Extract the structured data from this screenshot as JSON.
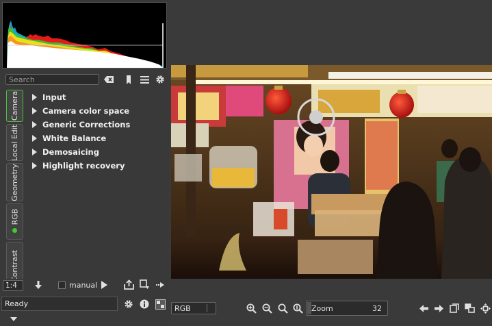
{
  "search": {
    "placeholder": "Search",
    "value": ""
  },
  "toolbar_icons": [
    "clear-search-icon",
    "bookmark-icon",
    "menu-icon",
    "gear-icon"
  ],
  "tabs": [
    {
      "label": "Camera",
      "active": true
    },
    {
      "label": "Local Edit",
      "active": false
    },
    {
      "label": "Geometry",
      "active": false
    },
    {
      "label": "RGB",
      "active": false
    },
    {
      "label": "Contrast",
      "active": false
    }
  ],
  "tools": [
    {
      "label": "Input"
    },
    {
      "label": "Camera color space"
    },
    {
      "label": "Generic Corrections"
    },
    {
      "label": "White Balance"
    },
    {
      "label": "Demosaicing"
    },
    {
      "label": "Highlight recovery"
    }
  ],
  "zoom_row": {
    "zoom_value": "1:4",
    "manual_label": "manual"
  },
  "status": {
    "text": "Ready"
  },
  "bottom": {
    "channel": "RGB",
    "zoom_label": "Zoom",
    "zoom_value": "32"
  },
  "colors": {
    "accent": "#46c23a",
    "panel": "#393939",
    "background": "#3a3a3a"
  }
}
